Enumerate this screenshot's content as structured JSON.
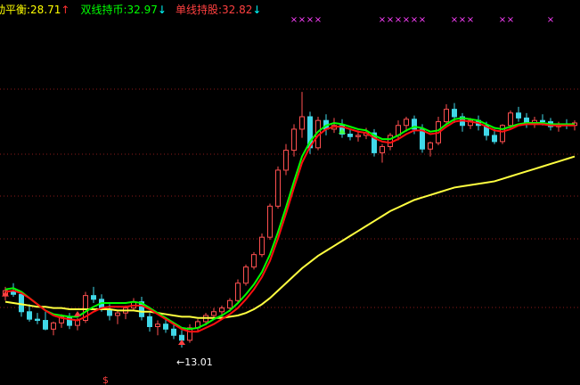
{
  "legend": {
    "item1_label": "动平衡:",
    "item1_value": "28.71",
    "item1_arrow": "↑",
    "item2_label": "双线持币:",
    "item2_value": "32.97",
    "item2_arrow": "↓",
    "item3_label": "单线持股:",
    "item3_value": "32.82",
    "item3_arrow": "↓"
  },
  "annotations": {
    "low_label": "←13.01",
    "dollar_marker": "$",
    "x_marker": "×"
  },
  "colors": {
    "background": "#000000",
    "grid": "#8b1a1a",
    "candle_up": "#ff5050",
    "candle_down": "#40d8e8",
    "line_fast": "#00ff00",
    "line_slow": "#ff1010",
    "line_ma": "#ffff40",
    "marker_x": "#ff40ff",
    "marker_buy": "#ff4040",
    "marker_sell": "#40ff40"
  },
  "chart_data": {
    "type": "candlestick",
    "ylim": [
      10,
      41
    ],
    "candles": [
      [
        17.2,
        17.9,
        16.8,
        17.6
      ],
      [
        17.6,
        18.2,
        17.1,
        17.3
      ],
      [
        17.3,
        17.5,
        15.5,
        15.9
      ],
      [
        15.9,
        16.5,
        15.1,
        15.3
      ],
      [
        15.3,
        15.8,
        14.9,
        15.2
      ],
      [
        15.2,
        15.9,
        14.4,
        14.5
      ],
      [
        14.5,
        15.1,
        14.0,
        15.0
      ],
      [
        15.0,
        15.7,
        14.6,
        15.5
      ],
      [
        15.5,
        15.8,
        14.5,
        14.8
      ],
      [
        14.8,
        15.4,
        14.4,
        15.2
      ],
      [
        15.2,
        17.5,
        15.0,
        17.2
      ],
      [
        17.2,
        17.9,
        16.6,
        16.9
      ],
      [
        16.9,
        17.3,
        15.9,
        16.1
      ],
      [
        16.1,
        16.5,
        15.2,
        15.6
      ],
      [
        15.6,
        16.0,
        14.9,
        15.8
      ],
      [
        15.8,
        16.4,
        15.3,
        16.2
      ],
      [
        16.2,
        17.0,
        16.0,
        16.7
      ],
      [
        16.7,
        17.1,
        15.2,
        15.5
      ],
      [
        15.5,
        15.8,
        14.3,
        14.7
      ],
      [
        14.7,
        15.2,
        14.0,
        14.9
      ],
      [
        14.9,
        15.4,
        14.2,
        14.5
      ],
      [
        14.5,
        14.9,
        13.7,
        14.0
      ],
      [
        14.0,
        14.4,
        13.01,
        13.6
      ],
      [
        13.6,
        14.9,
        13.4,
        14.6
      ],
      [
        14.6,
        15.3,
        14.3,
        15.1
      ],
      [
        15.1,
        15.8,
        14.8,
        15.6
      ],
      [
        15.6,
        16.2,
        15.3,
        15.9
      ],
      [
        15.9,
        16.4,
        15.5,
        16.2
      ],
      [
        16.2,
        17.0,
        15.9,
        16.8
      ],
      [
        16.8,
        18.5,
        16.6,
        18.2
      ],
      [
        18.2,
        19.7,
        18.0,
        19.5
      ],
      [
        19.5,
        20.7,
        19.3,
        20.5
      ],
      [
        20.5,
        22.2,
        20.3,
        21.9
      ],
      [
        21.9,
        24.6,
        21.7,
        24.4
      ],
      [
        24.4,
        27.6,
        24.2,
        27.3
      ],
      [
        27.3,
        29.4,
        26.9,
        28.9
      ],
      [
        28.9,
        31.0,
        28.4,
        30.6
      ],
      [
        30.6,
        33.6,
        29.9,
        31.6
      ],
      [
        31.6,
        32.0,
        28.6,
        29.1
      ],
      [
        29.1,
        31.6,
        28.9,
        31.3
      ],
      [
        31.3,
        31.8,
        30.1,
        30.6
      ],
      [
        30.6,
        31.5,
        30.3,
        30.9
      ],
      [
        30.9,
        31.4,
        29.9,
        30.2
      ],
      [
        30.2,
        30.6,
        29.7,
        30.0
      ],
      [
        30.0,
        30.5,
        29.6,
        30.1
      ],
      [
        30.1,
        30.7,
        29.8,
        30.3
      ],
      [
        30.3,
        30.6,
        28.4,
        28.7
      ],
      [
        28.7,
        29.4,
        27.9,
        29.2
      ],
      [
        29.2,
        30.3,
        28.9,
        30.1
      ],
      [
        30.1,
        31.3,
        29.7,
        30.9
      ],
      [
        30.9,
        31.6,
        30.4,
        31.4
      ],
      [
        31.4,
        31.7,
        30.2,
        30.6
      ],
      [
        30.6,
        31.0,
        28.7,
        29.0
      ],
      [
        29.0,
        29.6,
        28.4,
        29.5
      ],
      [
        29.5,
        31.6,
        29.3,
        31.2
      ],
      [
        31.2,
        32.6,
        30.9,
        32.2
      ],
      [
        32.2,
        32.7,
        31.1,
        31.6
      ],
      [
        31.6,
        31.9,
        30.4,
        30.9
      ],
      [
        30.9,
        31.5,
        30.6,
        31.3
      ],
      [
        31.3,
        31.7,
        30.5,
        30.9
      ],
      [
        30.9,
        31.2,
        29.7,
        30.1
      ],
      [
        30.1,
        30.6,
        29.4,
        29.6
      ],
      [
        29.6,
        31.0,
        29.4,
        30.9
      ],
      [
        30.9,
        32.1,
        30.6,
        31.9
      ],
      [
        31.9,
        32.4,
        31.2,
        31.5
      ],
      [
        31.5,
        31.9,
        30.7,
        31.0
      ],
      [
        31.0,
        31.6,
        30.7,
        31.3
      ],
      [
        31.3,
        31.8,
        30.9,
        31.2
      ],
      [
        31.2,
        31.5,
        30.5,
        30.8
      ],
      [
        30.8,
        31.2,
        30.4,
        31.0
      ],
      [
        31.0,
        31.4,
        30.6,
        30.9
      ],
      [
        30.9,
        31.3,
        30.5,
        31.1
      ]
    ],
    "fast_line": [
      17.7,
      17.8,
      17.5,
      17.0,
      16.5,
      16.0,
      15.7,
      15.6,
      15.5,
      15.5,
      15.9,
      16.3,
      16.6,
      16.6,
      16.6,
      16.6,
      16.7,
      16.6,
      16.2,
      15.8,
      15.4,
      15.0,
      14.6,
      14.5,
      14.6,
      14.9,
      15.3,
      15.6,
      16.0,
      16.6,
      17.3,
      18.1,
      19.1,
      20.5,
      22.3,
      24.3,
      26.4,
      28.4,
      29.6,
      30.4,
      30.9,
      31.1,
      31.0,
      30.8,
      30.6,
      30.5,
      30.1,
      29.8,
      29.8,
      30.1,
      30.5,
      30.8,
      30.7,
      30.4,
      30.5,
      31.0,
      31.4,
      31.5,
      31.4,
      31.3,
      31.0,
      30.7,
      30.6,
      30.8,
      31.0,
      31.1,
      31.1,
      31.1,
      31.0,
      31.0,
      31.0,
      31.0
    ],
    "slow_line": [
      17.5,
      17.6,
      17.4,
      17.0,
      16.5,
      16.0,
      15.6,
      15.4,
      15.3,
      15.2,
      15.5,
      15.9,
      16.2,
      16.3,
      16.3,
      16.3,
      16.4,
      16.4,
      16.1,
      15.7,
      15.3,
      14.9,
      14.5,
      14.3,
      14.3,
      14.6,
      14.9,
      15.3,
      15.7,
      16.2,
      16.9,
      17.7,
      18.7,
      20.0,
      21.8,
      23.8,
      25.9,
      27.9,
      29.2,
      30.1,
      30.6,
      30.8,
      30.8,
      30.6,
      30.4,
      30.3,
      29.9,
      29.6,
      29.5,
      29.8,
      30.2,
      30.5,
      30.5,
      30.2,
      30.3,
      30.8,
      31.2,
      31.3,
      31.2,
      31.1,
      30.8,
      30.5,
      30.4,
      30.6,
      30.9,
      31.0,
      31.0,
      31.0,
      30.9,
      30.9,
      30.9,
      30.9
    ],
    "ma_line": [
      16.7,
      16.6,
      16.5,
      16.4,
      16.3,
      16.3,
      16.2,
      16.2,
      16.1,
      16.1,
      16.1,
      16.1,
      16.1,
      16.1,
      16.0,
      16.0,
      16.0,
      15.9,
      15.9,
      15.8,
      15.7,
      15.6,
      15.5,
      15.5,
      15.4,
      15.4,
      15.4,
      15.4,
      15.5,
      15.6,
      15.8,
      16.1,
      16.5,
      17.0,
      17.6,
      18.2,
      18.8,
      19.4,
      19.9,
      20.4,
      20.8,
      21.2,
      21.6,
      22.0,
      22.4,
      22.8,
      23.2,
      23.6,
      24.0,
      24.3,
      24.6,
      24.9,
      25.1,
      25.3,
      25.5,
      25.7,
      25.9,
      26.0,
      26.1,
      26.2,
      26.3,
      26.4,
      26.6,
      26.8,
      27.0,
      27.2,
      27.4,
      27.6,
      27.8,
      28.0,
      28.2,
      28.4
    ],
    "x_marker_indices": [
      36,
      37,
      38,
      39,
      47,
      48,
      49,
      50,
      51,
      52,
      56,
      57,
      58,
      62,
      63,
      68
    ]
  }
}
